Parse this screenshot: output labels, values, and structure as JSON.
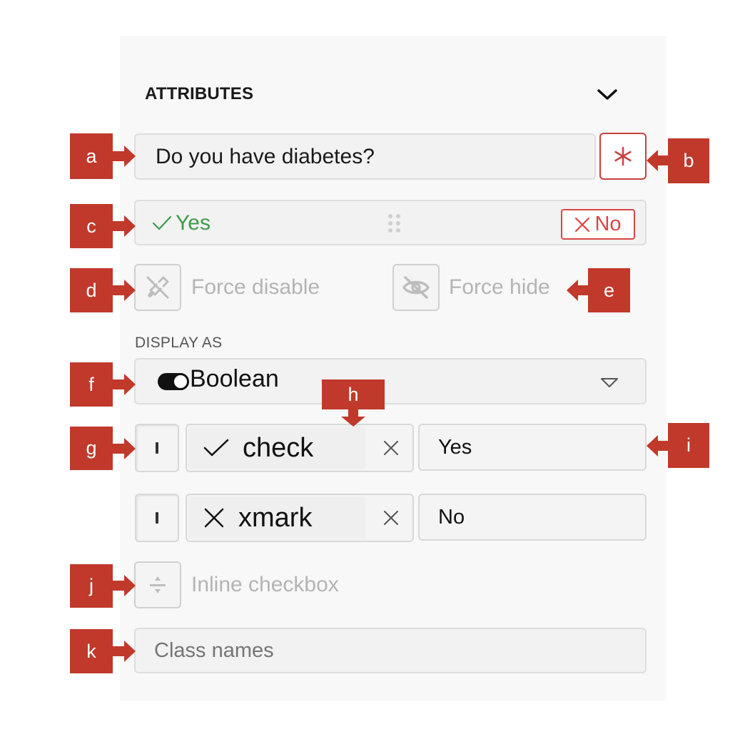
{
  "section": {
    "title": "ATTRIBUTES"
  },
  "question": {
    "value": "Do you have diabetes?"
  },
  "answers": {
    "yes": "Yes",
    "no": "No"
  },
  "toggles": {
    "force_disable": "Force disable",
    "force_hide": "Force hide",
    "inline_checkbox": "Inline checkbox"
  },
  "display_as": {
    "label": "DISPLAY AS",
    "selected": "Boolean"
  },
  "options": [
    {
      "icon": "check",
      "value": "Yes"
    },
    {
      "icon": "xmark",
      "value": "No"
    }
  ],
  "class_names": {
    "placeholder": "Class names"
  },
  "callouts": [
    "a",
    "b",
    "c",
    "d",
    "e",
    "f",
    "g",
    "h",
    "i",
    "j",
    "k"
  ],
  "colors": {
    "callout": "#c0392b",
    "yes": "#3f9c4a",
    "no": "#d94545",
    "required": "#c94040"
  }
}
